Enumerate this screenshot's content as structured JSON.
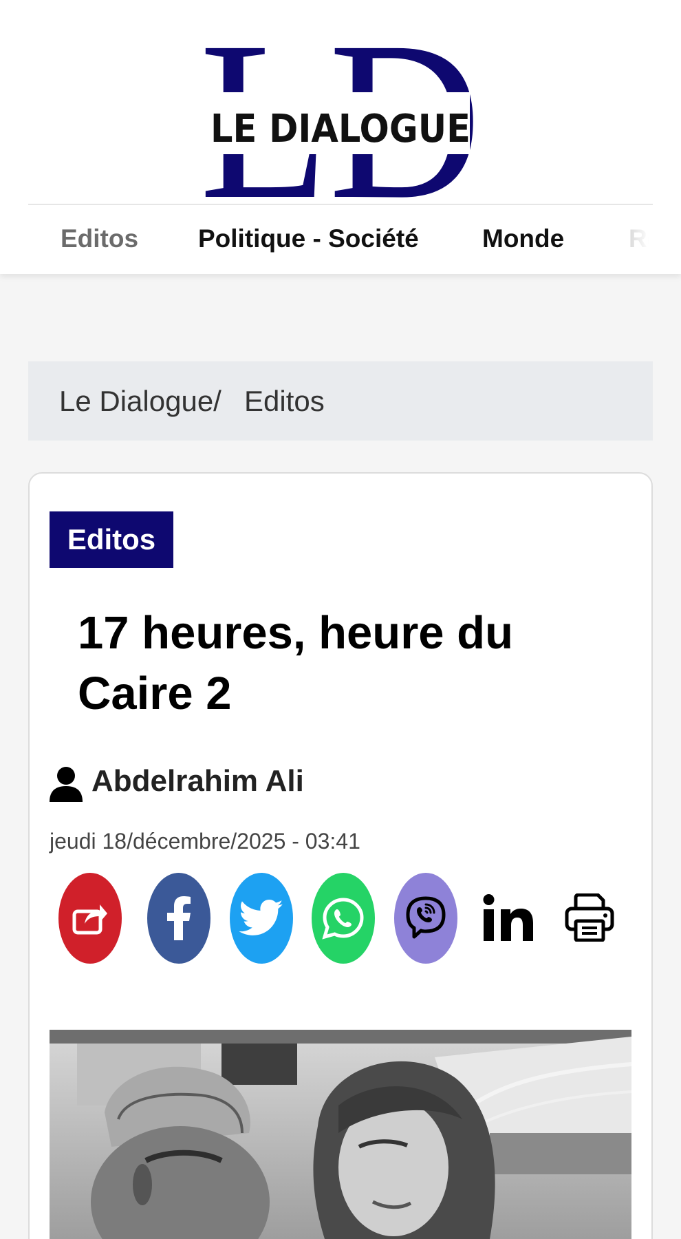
{
  "site": {
    "logo_letters": "LD",
    "logo_text": "LE DIALOGUE",
    "brand_color": "#0e0870"
  },
  "nav": {
    "items": [
      {
        "label": "Editos"
      },
      {
        "label": "Politique - Société"
      },
      {
        "label": "Monde"
      },
      {
        "label": "Re"
      }
    ]
  },
  "breadcrumb": {
    "home": "Le Dialogue/",
    "current": "Editos"
  },
  "article": {
    "category": "Editos",
    "title": "17 heures, heure du Caire 2",
    "author": "Abdelrahim Ali",
    "date": "jeudi 18/décembre/2025 - 03:41",
    "image_icon": "article-photo"
  },
  "share": {
    "buttons": [
      {
        "icon": "share-icon",
        "color": "#d0202a"
      },
      {
        "icon": "facebook-icon",
        "color": "#3b5998"
      },
      {
        "icon": "twitter-icon",
        "color": "#1da1f2"
      },
      {
        "icon": "whatsapp-icon",
        "color": "#25d366"
      },
      {
        "icon": "viber-icon",
        "color": "#8e82d8"
      },
      {
        "icon": "linkedin-icon",
        "color": "#000000"
      },
      {
        "icon": "print-icon",
        "color": "#000000"
      }
    ]
  }
}
